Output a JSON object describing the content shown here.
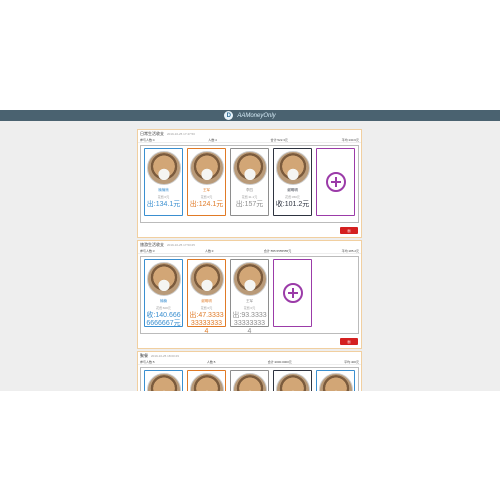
{
  "app": {
    "logo_letter": "D",
    "name": "AAMoneyOnly"
  },
  "panels": [
    {
      "title": "日常生活收支",
      "date": "2019-10-25 17:47:50",
      "info": [
        "参与人数:4",
        "人数:4",
        "合计:522.3元",
        "平均:130.6元"
      ],
      "cards": [
        {
          "name": "楠楠熊",
          "meta": "花费:0元",
          "amount": "出:134.1元",
          "color": "#3a8fd0"
        },
        {
          "name": "王军",
          "meta": "花费:0元",
          "amount": "出:124.1元",
          "color": "#e07a26"
        },
        {
          "name": "李四",
          "meta": "花费:11.1元",
          "amount": "出:157元",
          "color": "#8e8e8e"
        },
        {
          "name": "谢明明",
          "meta": "花费:360元",
          "amount": "收:101.2元",
          "color": "#2e3340"
        }
      ],
      "delete_label": "删"
    },
    {
      "title": "旅游生活收支",
      "date": "2019-10-25 17:53:25",
      "info": [
        "参与人数:3",
        "人数:3",
        "合计:555.5555555元",
        "平均:185.2元"
      ],
      "cards": [
        {
          "name": "楠楠",
          "meta": "花费:600元",
          "amount": "收:140.6666666667元",
          "color": "#3a8fd0"
        },
        {
          "name": "谢明明",
          "meta": "花费:0元",
          "amount": "出:47.3333333333334",
          "color": "#e07a26"
        },
        {
          "name": "王军",
          "meta": "花费:0元",
          "amount": "出:93.3333333333334",
          "color": "#8e8e8e"
        }
      ],
      "delete_label": "删"
    },
    {
      "title": "聚餐",
      "date": "2019-10-25 18:00:29",
      "info": [
        "参与人数:5",
        "人数:5",
        "合计:2000.0000元",
        "平均:400元"
      ],
      "cards": [
        {
          "name": "",
          "meta": "",
          "amount": "",
          "color": "#3a8fd0"
        },
        {
          "name": "",
          "meta": "",
          "amount": "",
          "color": "#e07a26"
        },
        {
          "name": "",
          "meta": "",
          "amount": "",
          "color": "#8e8e8e"
        },
        {
          "name": "",
          "meta": "",
          "amount": "",
          "color": "#2e3340"
        },
        {
          "name": "",
          "meta": "",
          "amount": "",
          "color": "#3a8fd0"
        }
      ]
    }
  ]
}
